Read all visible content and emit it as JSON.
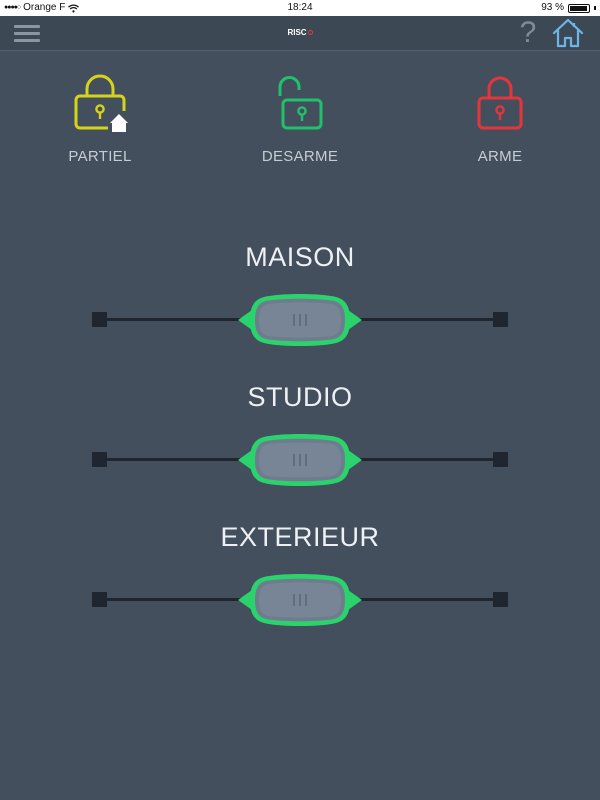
{
  "status_bar": {
    "carrier": "Orange F",
    "signal_dots": "●●●●○",
    "time": "18:24",
    "battery_percent_label": "93 %",
    "battery_level": 0.93
  },
  "nav": {
    "brand": "RISC",
    "help_glyph": "?",
    "menu_icon": "hamburger-menu-icon",
    "home_icon": "home-icon"
  },
  "states": [
    {
      "label": "PARTIEL",
      "color": "#d6d31c",
      "icon": "lock-closed-home-icon"
    },
    {
      "label": "DESARME",
      "color": "#21c16b",
      "icon": "lock-open-icon"
    },
    {
      "label": "ARME",
      "color": "#e5353c",
      "icon": "lock-closed-icon"
    }
  ],
  "partitions": [
    {
      "name": "MAISON",
      "state": "DESARME"
    },
    {
      "name": "STUDIO",
      "state": "DESARME"
    },
    {
      "name": "EXTERIEUR",
      "state": "DESARME"
    }
  ],
  "colors": {
    "background": "#434f5d",
    "nav_background": "#3d4855",
    "slider_accent": "#2ad36b",
    "home_icon": "#6bb7e8"
  }
}
